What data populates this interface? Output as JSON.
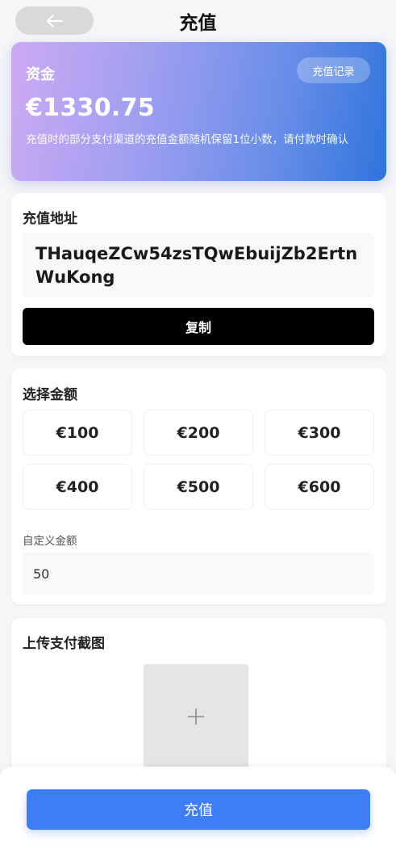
{
  "header": {
    "title": "充值"
  },
  "balance": {
    "label": "资金",
    "records_button": "充值记录",
    "amount": "€1330.75",
    "note": "充值时的部分支付渠道的充值金额随机保留1位小数，请付款时确认"
  },
  "address": {
    "title": "充值地址",
    "value": "THauqeZCw54zsTQwEbuijZb2ErtnWuKong",
    "copy_button": "复制"
  },
  "amount": {
    "title": "选择金额",
    "options": [
      "€100",
      "€200",
      "€300",
      "€400",
      "€500",
      "€600"
    ],
    "custom_label": "自定义金额",
    "custom_value": "50"
  },
  "upload": {
    "title": "上传支付截图",
    "icon": "plus-icon"
  },
  "submit": {
    "label": "充值"
  },
  "colors": {
    "primary": "#3d7ef5",
    "copy_button": "#000000"
  }
}
